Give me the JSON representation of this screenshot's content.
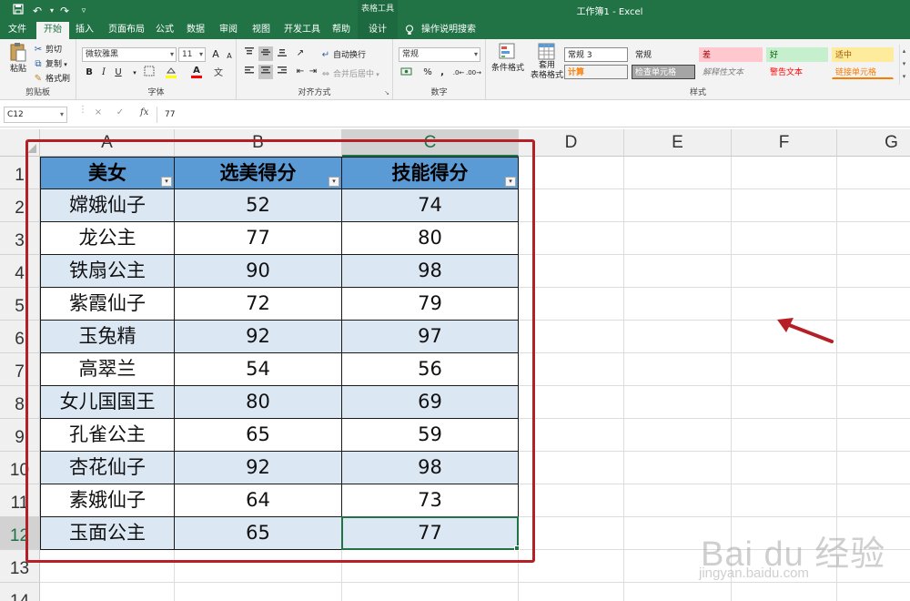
{
  "app": {
    "document_title": "工作簿1",
    "app_name": "Excel",
    "context_tools_label": "表格工具"
  },
  "quick_access": [
    "save-icon",
    "undo-icon",
    "redo-icon",
    "customize-icon"
  ],
  "tabs": {
    "file": "文件",
    "home": "开始",
    "insert": "插入",
    "page_layout": "页面布局",
    "formulas": "公式",
    "data": "数据",
    "review": "审阅",
    "view": "视图",
    "developer": "开发工具",
    "help": "帮助",
    "design": "设计",
    "tell_me": "操作说明搜索"
  },
  "ribbon": {
    "clipboard": {
      "label": "剪贴板",
      "paste": "粘贴",
      "cut": "剪切",
      "copy": "复制",
      "format_painter": "格式刷"
    },
    "font": {
      "label": "字体",
      "font_name": "微软雅黑",
      "font_size": "11",
      "grow": "A",
      "shrink": "A",
      "bold": "B",
      "italic": "I",
      "underline": "U",
      "font_color_letter": "A"
    },
    "alignment": {
      "label": "对齐方式",
      "wrap_text": "自动换行",
      "merge_center": "合并后居中"
    },
    "number": {
      "label": "数字",
      "format": "常规",
      "percent": "%",
      "comma": ","
    },
    "styles": {
      "label": "样式",
      "conditional_formatting": "条件格式",
      "format_as_table_line1": "套用",
      "format_as_table_line2": "表格格式",
      "cell_styles": [
        {
          "text": "常规 3",
          "bg": "#ffffff",
          "fg": "#222222",
          "border": "#8a8a8a"
        },
        {
          "text": "常规",
          "bg": "#f3f3f3",
          "fg": "#222222",
          "border": "#f3f3f3"
        },
        {
          "text": "差",
          "bg": "#ffc7ce",
          "fg": "#9c0006",
          "border": "#ffc7ce"
        },
        {
          "text": "好",
          "bg": "#c6efce",
          "fg": "#006100",
          "border": "#c6efce"
        },
        {
          "text": "适中",
          "bg": "#ffeb9c",
          "fg": "#9c5700",
          "border": "#ffeb9c"
        },
        {
          "text": "计算",
          "bg": "#f2f2f2",
          "fg": "#fa7d00",
          "border": "#7f7f7f"
        },
        {
          "text": "检查单元格",
          "bg": "#a5a5a5",
          "fg": "#ffffff",
          "border": "#3f3f3f"
        },
        {
          "text": "解释性文本",
          "bg": "#f3f3f3",
          "fg": "#7f7f7f",
          "border": "#f3f3f3"
        },
        {
          "text": "警告文本",
          "bg": "#f3f3f3",
          "fg": "#ff0000",
          "border": "#f3f3f3"
        },
        {
          "text": "链接单元格",
          "bg": "#f3f3f3",
          "fg": "#fa7d00",
          "border": "#f3f3f3"
        }
      ]
    }
  },
  "formula_bar": {
    "name_box": "C12",
    "cancel": "×",
    "enter": "✓",
    "fx": "fx",
    "content": "77"
  },
  "sheet": {
    "columns": [
      "A",
      "B",
      "C",
      "D",
      "E",
      "F",
      "G"
    ],
    "selected_column": "C",
    "rows": [
      "1",
      "2",
      "3",
      "4",
      "5",
      "6",
      "7",
      "8",
      "9",
      "10",
      "11",
      "12",
      "13",
      "14"
    ],
    "selected_row": "12",
    "table_headers": [
      "美女",
      "选美得分",
      "技能得分"
    ],
    "table_rows": [
      [
        "嫦娥仙子",
        "52",
        "74"
      ],
      [
        "龙公主",
        "77",
        "80"
      ],
      [
        "铁扇公主",
        "90",
        "98"
      ],
      [
        "紫霞仙子",
        "72",
        "79"
      ],
      [
        "玉兔精",
        "92",
        "97"
      ],
      [
        "高翠兰",
        "54",
        "56"
      ],
      [
        "女儿国国王",
        "80",
        "69"
      ],
      [
        "孔雀公主",
        "65",
        "59"
      ],
      [
        "杏花仙子",
        "92",
        "98"
      ],
      [
        "素娥仙子",
        "64",
        "73"
      ],
      [
        "玉面公主",
        "65",
        "77"
      ]
    ],
    "active_cell": "C12",
    "colors": {
      "header_fill": "#5b9bd5",
      "band_fill": "#dce7f4",
      "highlight_frame": "#b52027",
      "excel_green": "#217346"
    }
  },
  "watermark": {
    "line1": "Bai du 经验",
    "line2": "jingyan.baidu.com"
  }
}
